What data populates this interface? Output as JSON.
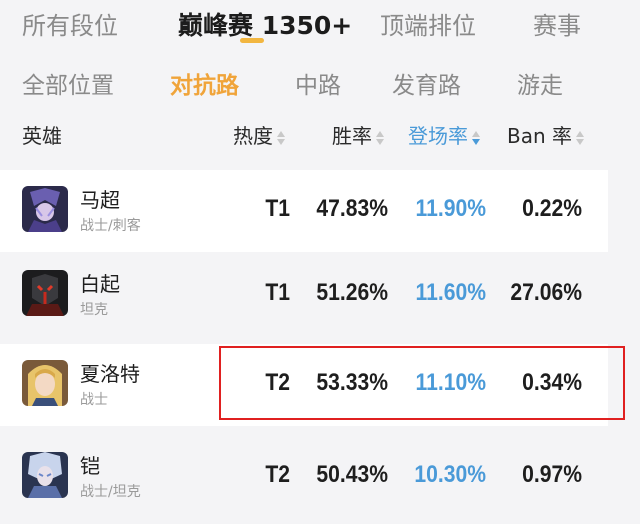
{
  "tabs_top": [
    {
      "label": "所有段位"
    },
    {
      "label": "巅峰赛 1350+"
    },
    {
      "label": "顶端排位"
    },
    {
      "label": "赛事"
    }
  ],
  "tabs_position": [
    {
      "label": "全部位置"
    },
    {
      "label": "对抗路"
    },
    {
      "label": "中路"
    },
    {
      "label": "发育路"
    },
    {
      "label": "游走"
    }
  ],
  "table_header": {
    "hero": "英雄",
    "heat": "热度",
    "win_rate": "胜率",
    "pick_rate": "登场率",
    "ban_rate": "Ban 率"
  },
  "rows": [
    {
      "name": "马超",
      "role": "战士/刺客",
      "tier": "T1",
      "win": "47.83%",
      "pick": "11.90%",
      "ban": "0.22%"
    },
    {
      "name": "白起",
      "role": "坦克",
      "tier": "T1",
      "win": "51.26%",
      "pick": "11.60%",
      "ban": "27.06%"
    },
    {
      "name": "夏洛特",
      "role": "战士",
      "tier": "T2",
      "win": "53.33%",
      "pick": "11.10%",
      "ban": "0.34%"
    },
    {
      "name": "铠",
      "role": "战士/坦克",
      "tier": "T2",
      "win": "50.43%",
      "pick": "10.30%",
      "ban": "0.97%"
    }
  ],
  "colors": {
    "accent": "#f2b640",
    "active_position": "#f0a43a",
    "pick_rate": "#4a9ad8",
    "highlight": "#e02020"
  }
}
